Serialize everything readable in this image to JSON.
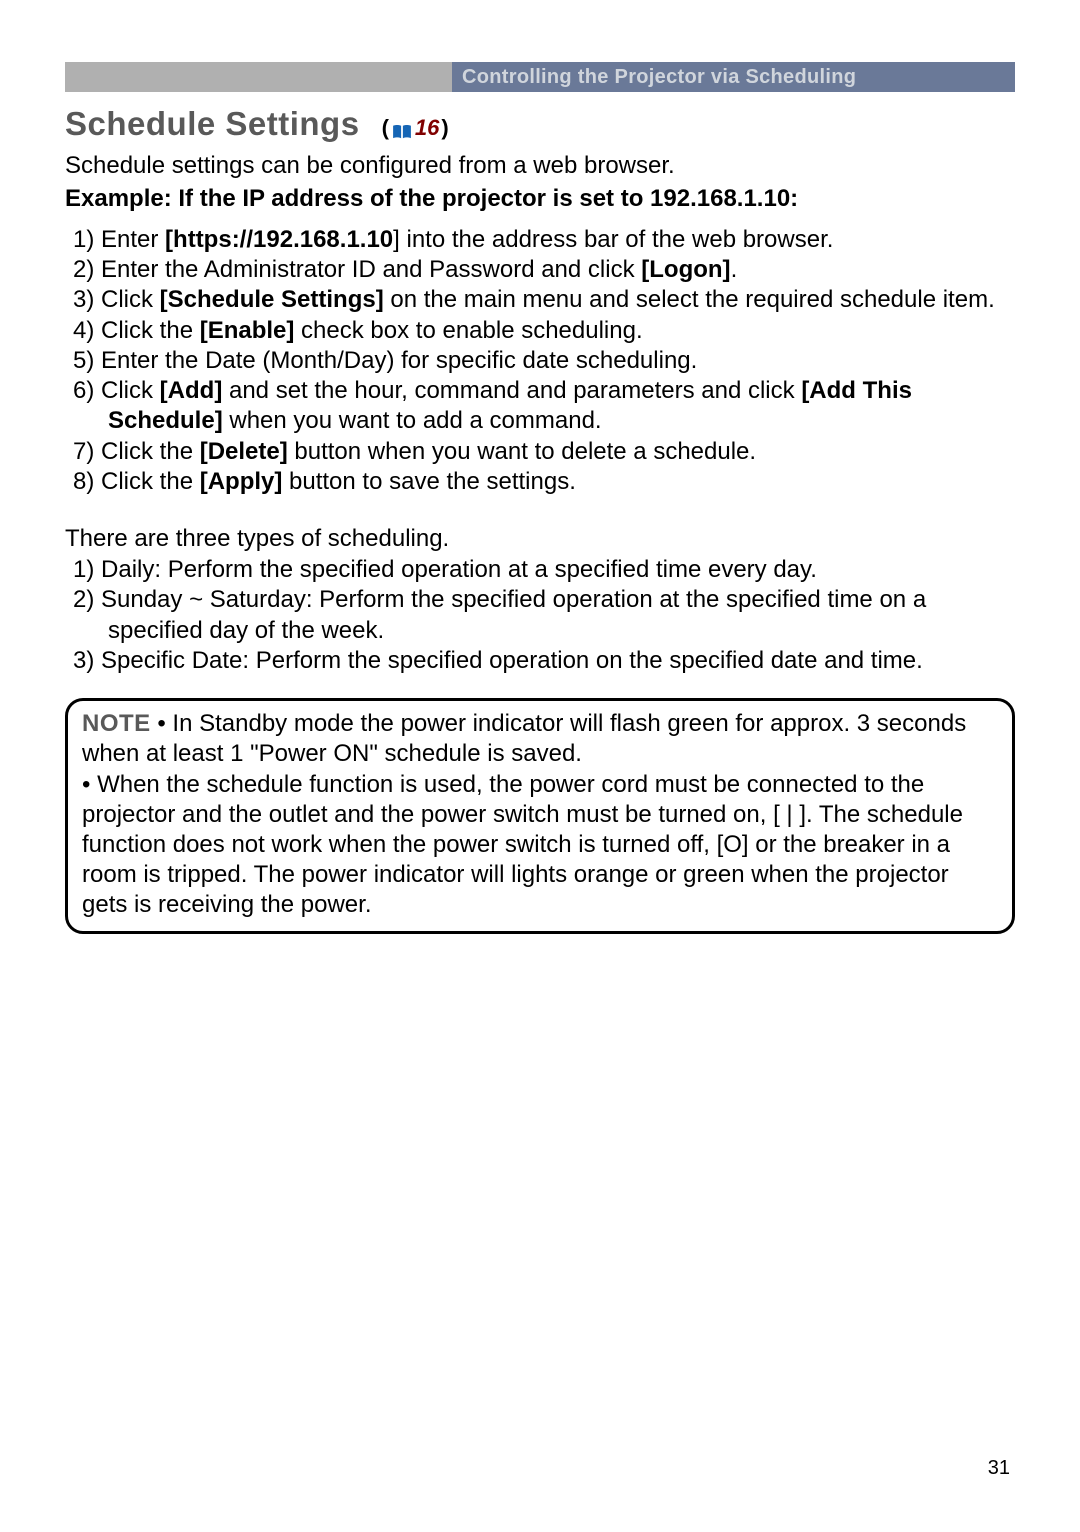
{
  "header": {
    "section_title": "Controlling the Projector via Scheduling"
  },
  "title": {
    "heading": "Schedule Settings",
    "ref_open": "(",
    "ref_num": "16",
    "ref_close": ")"
  },
  "intro": "Schedule settings can be configured from a web browser.",
  "example": "Example: If the IP address of the projector is set to 192.168.1.10:",
  "step1_a": "1) Enter ",
  "step1_b": "[https://192.168.1.10",
  "step1_c": "] into the address bar of the web browser.",
  "step2_a": "2) Enter the Administrator ID and Password and click ",
  "step2_b": "[Logon]",
  "step2_c": ".",
  "step3_a": "3) Click ",
  "step3_b": "[Schedule Settings]",
  "step3_c": " on the main menu and select the required schedule item.",
  "step4_a": "4) Click the ",
  "step4_b": "[Enable]",
  "step4_c": " check box to enable scheduling.",
  "step5": "5) Enter the Date (Month/Day) for specific date scheduling.",
  "step6_a": "6) Click ",
  "step6_b": "[Add]",
  "step6_c": " and set the hour, command and parameters and click ",
  "step6_d": "[Add This Schedule]",
  "step6_e": " when you want to add a command.",
  "step7_a": "7) Click the ",
  "step7_b": "[Delete]",
  "step7_c": " button when you want to delete a schedule.",
  "step8_a": "8) Click the ",
  "step8_b": "[Apply]",
  "step8_c": " button to save the settings.",
  "types_intro": "There are three types of scheduling.",
  "type1": "1) Daily: Perform the specified operation at a specified time every day.",
  "type2": "2) Sunday ~ Saturday: Perform the specified operation at the specified time on a specified day of the week.",
  "type3": "3) Specific Date: Perform the specified operation on the specified date and time.",
  "note_label": "NOTE",
  "note_body": " • In Standby mode the power indicator will flash green for approx. 3 seconds when at least 1 \"Power ON\" schedule is saved.\n• When the schedule function is used, the power cord must be connected to the projector and the outlet and the power switch must be turned on, [ | ]. The schedule function does not work when the power switch is turned off, [O] or the breaker in a room is tripped. The power indicator will lights orange or green when the projector gets is receiving the power.",
  "page_number": "31"
}
